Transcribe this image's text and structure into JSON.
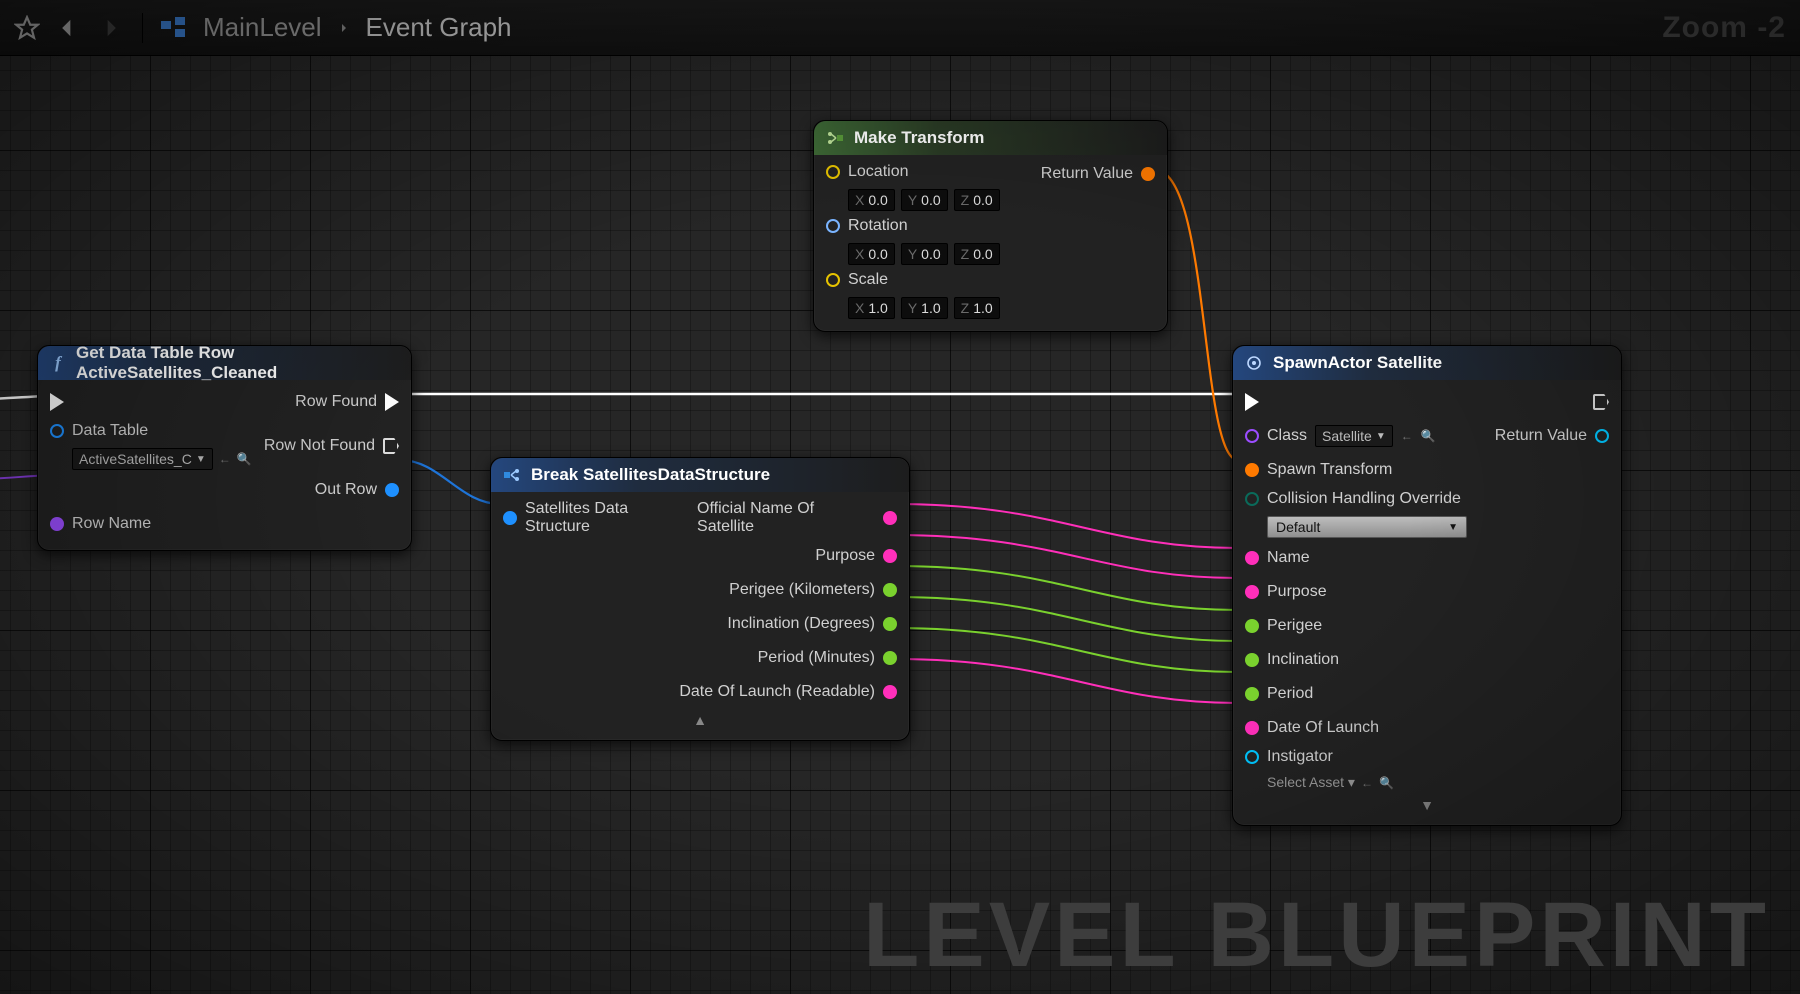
{
  "header": {
    "breadcrumb1": "MainLevel",
    "breadcrumb2": "Event Graph",
    "zoom": "Zoom -2"
  },
  "watermark": "LEVEL BLUEPRINT",
  "getNode": {
    "title": "Get Data Table Row ActiveSatellites_Cleaned",
    "dataTableLabel": "Data Table",
    "dataTableValue": "ActiveSatellites_C",
    "rowNameLabel": "Row Name",
    "rowFound": "Row Found",
    "rowNotFound": "Row Not Found",
    "outRow": "Out Row"
  },
  "breakNode": {
    "title": "Break SatellitesDataStructure",
    "input": "Satellites Data Structure",
    "out": [
      "Official Name Of Satellite",
      "Purpose",
      "Perigee (Kilometers)",
      "Inclination (Degrees)",
      "Period (Minutes)",
      "Date Of Launch (Readable)"
    ]
  },
  "makeNode": {
    "title": "Make Transform",
    "location": "Location",
    "rotation": "Rotation",
    "scale": "Scale",
    "returnValue": "Return Value",
    "loc": {
      "x": "0.0",
      "y": "0.0",
      "z": "0.0"
    },
    "rot": {
      "x": "0.0",
      "y": "0.0",
      "z": "0.0"
    },
    "scl": {
      "x": "1.0",
      "y": "1.0",
      "z": "1.0"
    }
  },
  "spawnNode": {
    "title": "SpawnActor Satellite",
    "classLabel": "Class",
    "classValue": "Satellite",
    "spawnTransform": "Spawn Transform",
    "collisionLabel": "Collision Handling Override",
    "collisionValue": "Default",
    "returnValue": "Return Value",
    "instigatorLabel": "Instigator",
    "instigatorValue": "Select Asset",
    "pins": [
      "Name",
      "Purpose",
      "Perigee",
      "Inclination",
      "Period",
      "Date Of Launch"
    ]
  }
}
